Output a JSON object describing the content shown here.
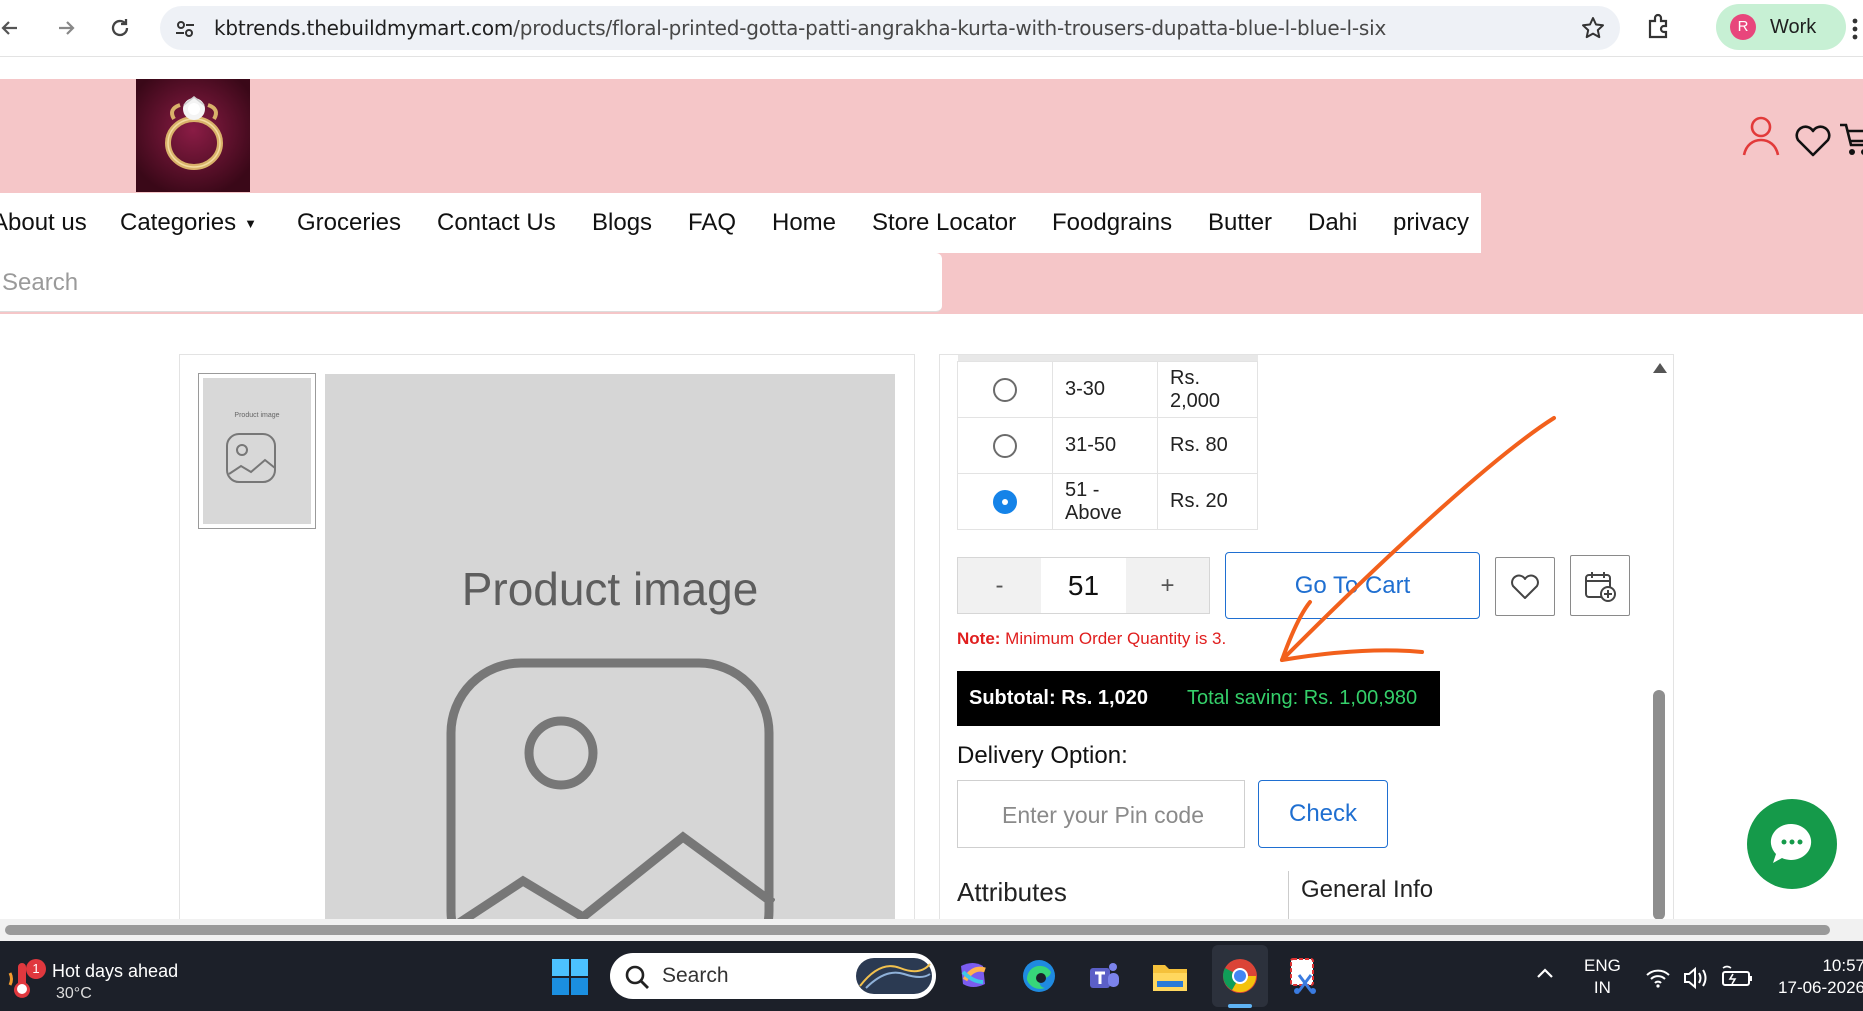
{
  "browser": {
    "url_host": "kbtrends.thebuildmymart.com",
    "url_path": "/products/floral-printed-gotta-patti-angrakha-kurta-with-trousers-dupatta-blue-l-blue-l-six",
    "profile_initial": "R",
    "profile_name": "Work"
  },
  "site": {
    "nav": [
      "About us",
      "Categories",
      "Groceries",
      "Contact Us",
      "Blogs",
      "FAQ",
      "Home",
      "Store Locator",
      "Foodgrains",
      "Butter",
      "Dahi",
      "privacy"
    ],
    "search_placeholder": "Search",
    "header_color": "#f5c6c8"
  },
  "product": {
    "thumb_label": "Product image",
    "image_label": "Product image",
    "tiers": [
      {
        "range": "3-30",
        "price": "Rs. 2,000",
        "selected": false
      },
      {
        "range": "31-50",
        "price": "Rs. 80",
        "selected": false
      },
      {
        "range": "51 - Above",
        "price": "Rs. 20",
        "selected": true
      }
    ],
    "qty_minus": "-",
    "qty_value": "51",
    "qty_plus": "+",
    "go_to_cart": "Go To Cart",
    "note_label": "Note:",
    "note_text": " Minimum Order Quantity is 3.",
    "subtotal": "Subtotal: Rs. 1,020",
    "total_saving": "Total saving: Rs. 1,00,980",
    "delivery_title": "Delivery Option:",
    "pin_placeholder": "Enter your Pin code",
    "check_label": "Check",
    "tab_attributes": "Attributes",
    "tab_general": "General Info"
  },
  "taskbar": {
    "weather_badge": "1",
    "weather_title": "Hot days ahead",
    "weather_temp": "30°C",
    "search_label": "Search",
    "lang_line1": "ENG",
    "lang_line2": "IN",
    "time": "10:57",
    "date": "17-06-2026"
  }
}
